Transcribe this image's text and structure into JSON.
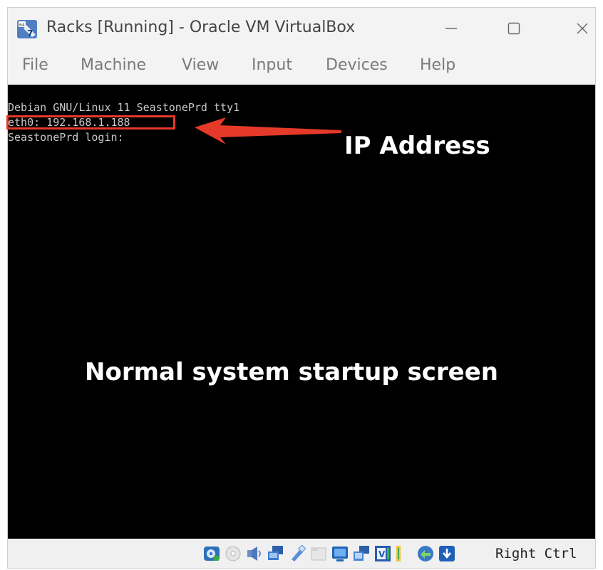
{
  "window": {
    "title": "Racks [Running] - Oracle VM VirtualBox",
    "controls": [
      "minimize-icon",
      "maximize-icon",
      "close-icon"
    ]
  },
  "menu": [
    "File",
    "Machine",
    "View",
    "Input",
    "Devices",
    "Help"
  ],
  "terminal": {
    "line1": "Debian GNU/Linux 11 SeastonePrd tty1",
    "line2": "eth0: 192.168.1.188",
    "line3": "SeastonePrd login:"
  },
  "annotations": {
    "ip_label": "IP Address",
    "caption": "Normal system startup screen",
    "highlight_color": "#e53a2a"
  },
  "status_bar": {
    "icons": [
      "hard-disk-icon",
      "optical-drive-icon",
      "audio-icon",
      "network-icon",
      "usb-icon",
      "shared-folders-icon",
      "display-icon",
      "snapshot-icon",
      "recording-icon",
      "cpu-icon",
      "mouse-integration-icon",
      "keyboard-capture-icon"
    ],
    "host_key": "Right Ctrl"
  }
}
